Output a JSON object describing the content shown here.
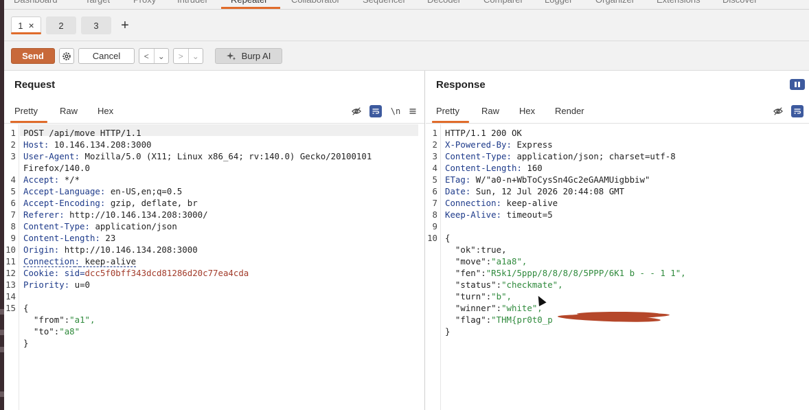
{
  "tool_tabs": [
    "Dashboard",
    "Target",
    "Proxy",
    "Intruder",
    "Repeater",
    "Collaborator",
    "Sequencer",
    "Decoder",
    "Comparer",
    "Logger",
    "Organizer",
    "Extensions",
    "Discover"
  ],
  "repeater_tabs": [
    {
      "label": "1",
      "close": "×"
    },
    {
      "label": "2"
    },
    {
      "label": "3"
    }
  ],
  "add_tab": "+",
  "toolbar": {
    "send_label": "Send",
    "cancel_label": "Cancel",
    "back": "<",
    "forward": ">",
    "dropdown": "⌄",
    "burp_ai_label": "Burp AI"
  },
  "request": {
    "title": "Request",
    "tabs": [
      "Pretty",
      "Raw",
      "Hex"
    ],
    "newline_label": "\\n",
    "lines": [
      {
        "n": "1",
        "k": "",
        "v": "POST /api/move HTTP/1.1"
      },
      {
        "n": "2",
        "k": "Host",
        "v": " 10.146.134.208:3000"
      },
      {
        "n": "3",
        "k": "User-Agent",
        "v": " Mozilla/5.0 (X11; Linux x86_64; rv:140.0) Gecko/20100101"
      },
      {
        "n": "",
        "k": "",
        "v": "Firefox/140.0"
      },
      {
        "n": "4",
        "k": "Accept",
        "v": " */*"
      },
      {
        "n": "5",
        "k": "Accept-Language",
        "v": " en-US,en;q=0.5"
      },
      {
        "n": "6",
        "k": "Accept-Encoding",
        "v": " gzip, deflate, br"
      },
      {
        "n": "7",
        "k": "Referer",
        "v": " http://10.146.134.208:3000/"
      },
      {
        "n": "8",
        "k": "Content-Type",
        "v": " application/json"
      },
      {
        "n": "9",
        "k": "Content-Length",
        "v": " 23"
      },
      {
        "n": "10",
        "k": "Origin",
        "v": " http://10.146.134.208:3000"
      },
      {
        "n": "11",
        "k": "Connection",
        "v": " keep-alive"
      },
      {
        "n": "12",
        "k": "Cookie",
        "v": " ",
        "cookie_name": "sid=",
        "cookie_value": "dcc5f0bff343dcd81286d20c77ea4cda"
      },
      {
        "n": "13",
        "k": "Priority",
        "v": " u=0"
      },
      {
        "n": "14",
        "k": "",
        "v": ""
      },
      {
        "n": "15",
        "k": "",
        "v": "{"
      },
      {
        "n": "",
        "k": "",
        "v": "  ",
        "jk": "\"from\"",
        "jv": "\"a1\","
      },
      {
        "n": "",
        "k": "",
        "v": "  ",
        "jk": "\"to\"",
        "jv": "\"a8\""
      },
      {
        "n": "",
        "k": "",
        "v": "}"
      }
    ]
  },
  "response": {
    "title": "Response",
    "tabs": [
      "Pretty",
      "Raw",
      "Hex",
      "Render"
    ],
    "lines": [
      {
        "n": "1",
        "k": "",
        "v": "HTTP/1.1 200 OK"
      },
      {
        "n": "2",
        "k": "X-Powered-By",
        "v": " Express"
      },
      {
        "n": "3",
        "k": "Content-Type",
        "v": " application/json; charset=utf-8"
      },
      {
        "n": "4",
        "k": "Content-Length",
        "v": " 160"
      },
      {
        "n": "5",
        "k": "ETag",
        "v": " W/\"a0-n+WbToCysSn4Gc2eGAAMUigbbiw\""
      },
      {
        "n": "6",
        "k": "Date",
        "v": " Sun, 12 Jul 2026 20:44:08 GMT"
      },
      {
        "n": "7",
        "k": "Connection",
        "v": " keep-alive"
      },
      {
        "n": "8",
        "k": "Keep-Alive",
        "v": " timeout=5"
      },
      {
        "n": "9",
        "k": "",
        "v": ""
      },
      {
        "n": "10",
        "k": "",
        "v": "{"
      },
      {
        "n": "",
        "k": "",
        "v": "  ",
        "jk": "\"ok\"",
        "jv": "true,",
        "plain": true
      },
      {
        "n": "",
        "k": "",
        "v": "  ",
        "jk": "\"move\"",
        "jv": "\"a1a8\","
      },
      {
        "n": "",
        "k": "",
        "v": "  ",
        "jk": "\"fen\"",
        "jv": "\"R5k1/5ppp/8/8/8/8/5PPP/6K1 b - - 1 1\","
      },
      {
        "n": "",
        "k": "",
        "v": "  ",
        "jk": "\"status\"",
        "jv": "\"checkmate\","
      },
      {
        "n": "",
        "k": "",
        "v": "  ",
        "jk": "\"turn\"",
        "jv": "\"b\","
      },
      {
        "n": "",
        "k": "",
        "v": "  ",
        "jk": "\"winner\"",
        "jv": "\"white\","
      },
      {
        "n": "",
        "k": "",
        "v": "  ",
        "jk": "\"flag\"",
        "jv": "\"THM{pr0t0_p"
      },
      {
        "n": "",
        "k": "",
        "v": "}"
      }
    ]
  },
  "colors": {
    "accent": "#e06c2b",
    "send": "#c8693a",
    "header_key": "#1d3a8a",
    "json_string": "#2f8a3c",
    "cookie_value": "#a23b2a",
    "redaction": "#b5472a"
  }
}
